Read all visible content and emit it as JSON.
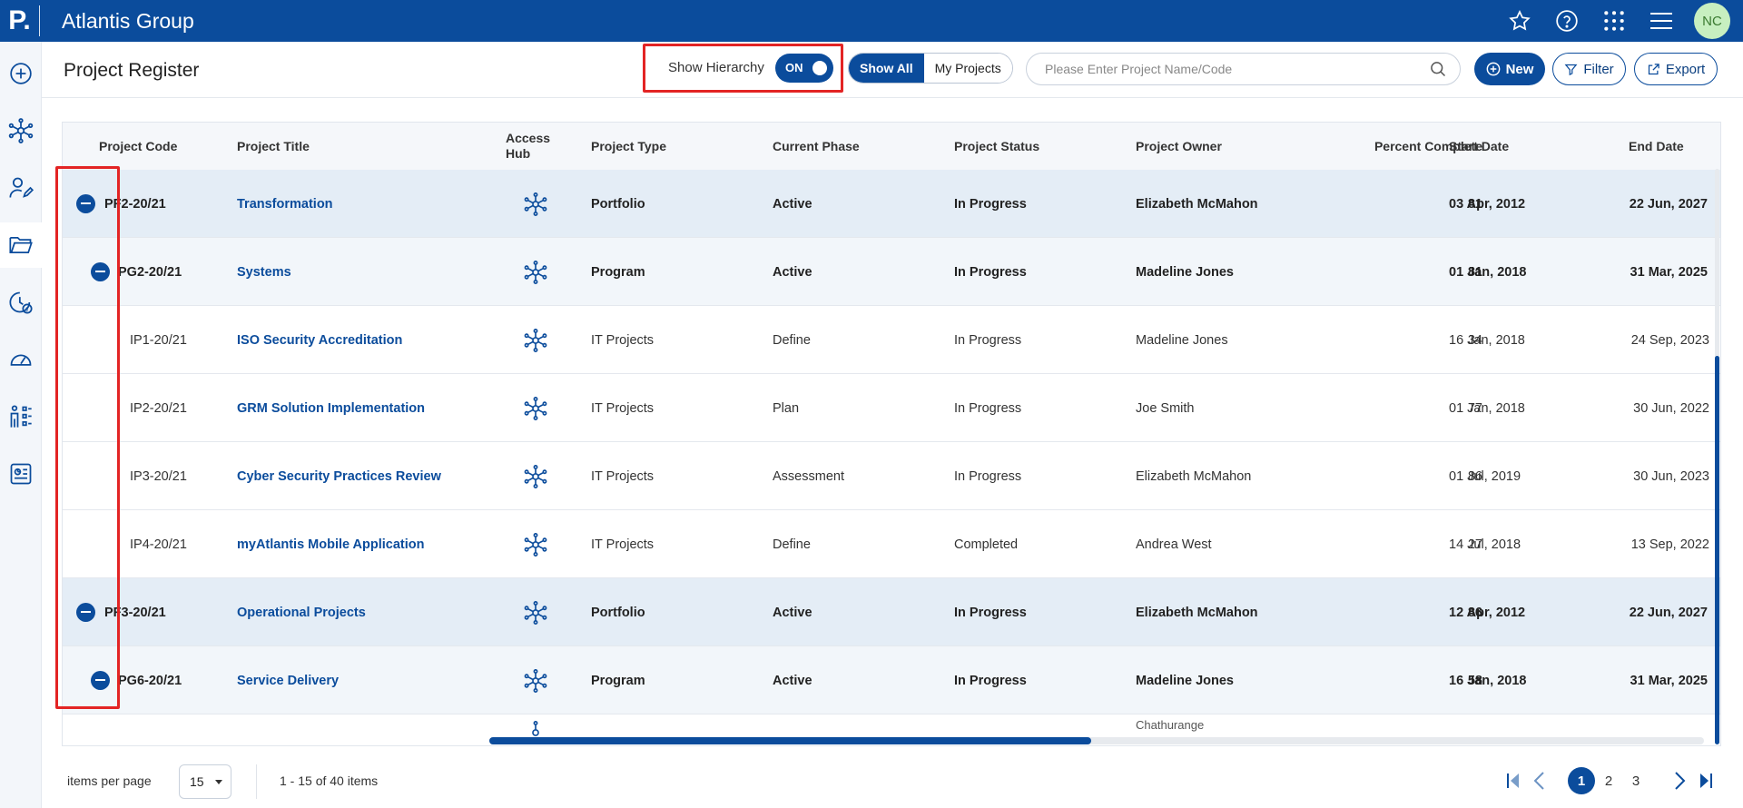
{
  "app": {
    "logo": "P.",
    "title": "Atlantis Group",
    "avatar": "NC"
  },
  "header": {
    "page_title": "Project Register",
    "show_hierarchy_label": "Show Hierarchy",
    "toggle_state": "ON",
    "view_show_all": "Show All",
    "view_my_projects": "My Projects",
    "search_placeholder": "Please Enter Project Name/Code",
    "new_label": "New",
    "filter_label": "Filter",
    "export_label": "Export"
  },
  "table": {
    "columns": {
      "code": "Project Code",
      "title": "Project Title",
      "hub": "Access Hub",
      "type": "Project Type",
      "phase": "Current Phase",
      "status": "Project Status",
      "owner": "Project Owner",
      "percent": "Percent Complete",
      "start": "Start Date",
      "end": "End Date"
    },
    "rows": [
      {
        "code": "PF2-20/21",
        "title": "Transformation",
        "type": "Portfolio",
        "phase": "Active",
        "status": "In Progress",
        "owner": "Elizabeth McMahon",
        "percent": "81",
        "start": "03 Apr, 2012",
        "end": "22 Jun, 2027"
      },
      {
        "code": "PG2-20/21",
        "title": "Systems",
        "type": "Program",
        "phase": "Active",
        "status": "In Progress",
        "owner": "Madeline Jones",
        "percent": "81",
        "start": "01 Jan, 2018",
        "end": "31 Mar, 2025"
      },
      {
        "code": "IP1-20/21",
        "title": "ISO Security Accreditation",
        "type": "IT Projects",
        "phase": "Define",
        "status": "In Progress",
        "owner": "Madeline Jones",
        "percent": "34",
        "start": "16 Jan, 2018",
        "end": "24 Sep, 2023"
      },
      {
        "code": "IP2-20/21",
        "title": "GRM Solution Implementation",
        "type": "IT Projects",
        "phase": "Plan",
        "status": "In Progress",
        "owner": "Joe Smith",
        "percent": "77",
        "start": "01 Jan, 2018",
        "end": "30 Jun, 2022"
      },
      {
        "code": "IP3-20/21",
        "title": "Cyber Security Practices Review",
        "type": "IT Projects",
        "phase": "Assessment",
        "status": "In Progress",
        "owner": "Elizabeth McMahon",
        "percent": "86",
        "start": "01 Jul, 2019",
        "end": "30 Jun, 2023"
      },
      {
        "code": "IP4-20/21",
        "title": "myAtlantis Mobile Application",
        "type": "IT Projects",
        "phase": "Define",
        "status": "Completed",
        "owner": "Andrea West",
        "percent": "27",
        "start": "14 Jul, 2018",
        "end": "13 Sep, 2022"
      },
      {
        "code": "PF3-20/21",
        "title": "Operational Projects",
        "type": "Portfolio",
        "phase": "Active",
        "status": "In Progress",
        "owner": "Elizabeth McMahon",
        "percent": "86",
        "start": "12 Apr, 2012",
        "end": "22 Jun, 2027"
      },
      {
        "code": "PG6-20/21",
        "title": "Service Delivery",
        "type": "Program",
        "phase": "Active",
        "status": "In Progress",
        "owner": "Madeline Jones",
        "percent": "58",
        "start": "16 Jan, 2018",
        "end": "31 Mar, 2025"
      }
    ],
    "partial_owner": "Chathurange"
  },
  "footer": {
    "items_per_page_label": "items per page",
    "items_per_page": "15",
    "range": "1 - 15 of 40 items",
    "pages": [
      "1",
      "2",
      "3"
    ]
  },
  "colors": {
    "brand": "#0b4c9c",
    "highlight": "#e32424",
    "avatar_bg": "#c7efc0"
  },
  "icons": [
    "star-icon",
    "help-icon",
    "apps-grid-icon",
    "menu-icon",
    "add-circle-icon",
    "hub-network-icon",
    "edit-person-icon",
    "folder-icon",
    "finance-icon",
    "dashboard-icon",
    "resources-icon",
    "report-icon",
    "search-icon",
    "filter-icon",
    "export-icon",
    "first-page-icon",
    "prev-page-icon",
    "next-page-icon",
    "last-page-icon"
  ]
}
